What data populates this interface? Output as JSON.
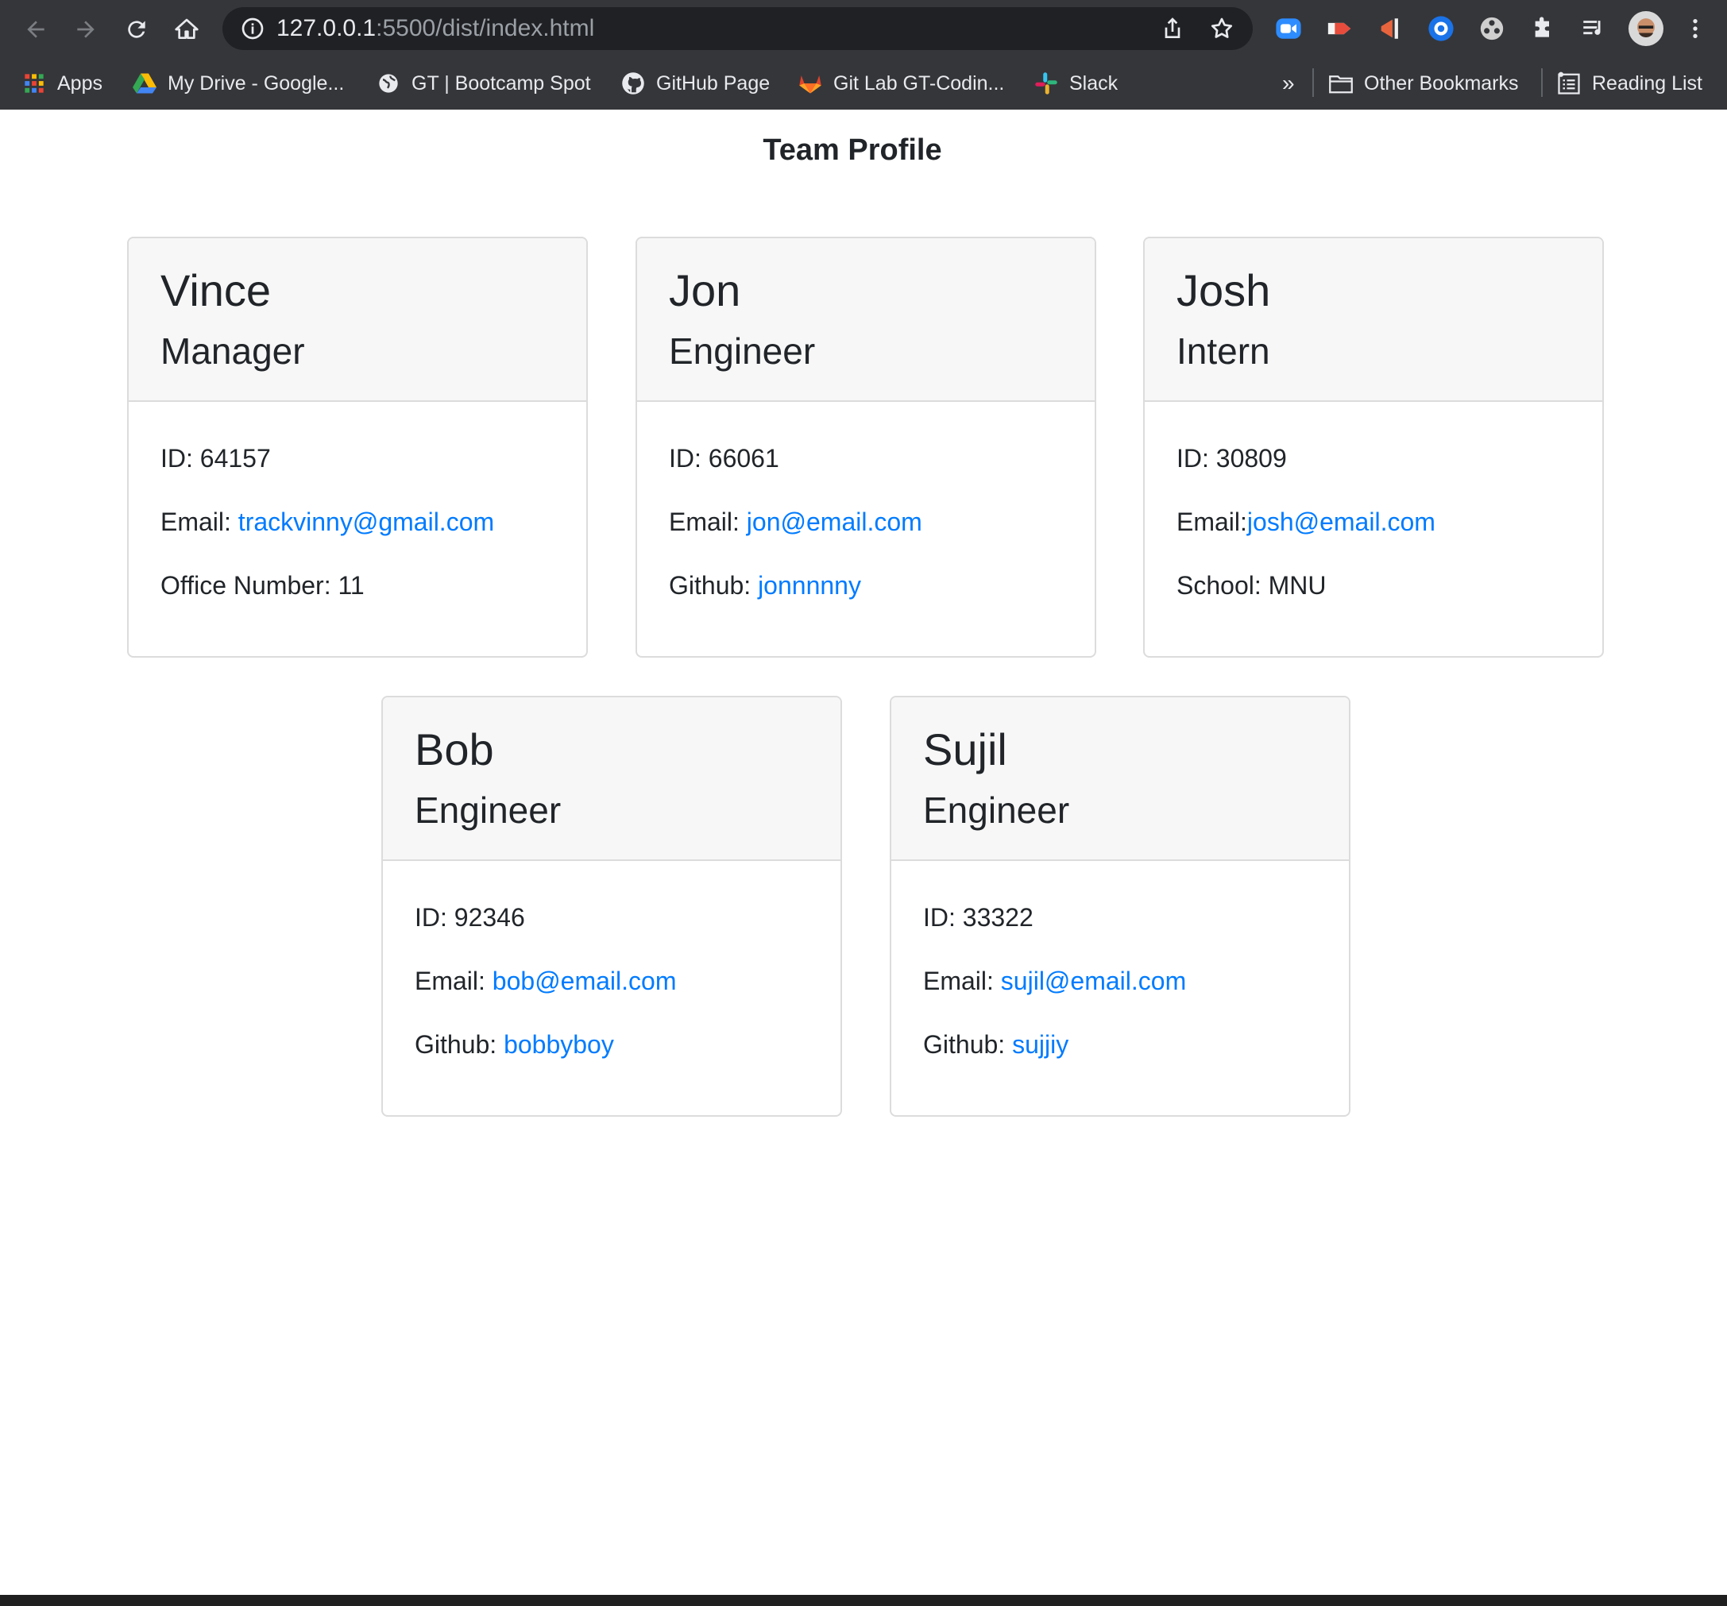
{
  "browser": {
    "url_host": "127.0.0.1",
    "url_path": ":5500/dist/index.html",
    "bookmarks": [
      {
        "label": "Apps",
        "icon": "apps-grid-icon"
      },
      {
        "label": "My Drive - Google...",
        "icon": "google-drive-icon"
      },
      {
        "label": "GT | Bootcamp Spot",
        "icon": "globe-icon"
      },
      {
        "label": "GitHub Page",
        "icon": "github-icon"
      },
      {
        "label": "Git Lab GT-Codin...",
        "icon": "gitlab-icon"
      },
      {
        "label": "Slack",
        "icon": "slack-icon"
      }
    ],
    "overflow_label": "»",
    "other_bookmarks": "Other Bookmarks",
    "reading_list": "Reading List"
  },
  "page": {
    "title": "Team Profile"
  },
  "team": [
    {
      "name": "Vince",
      "role": "Manager",
      "id_label": "ID: 64157",
      "email_label": "Email: ",
      "email": "trackvinny@gmail.com",
      "extra_label": "Office Number: 11",
      "extra_link": ""
    },
    {
      "name": "Jon",
      "role": "Engineer",
      "id_label": "ID: 66061",
      "email_label": "Email: ",
      "email": "jon@email.com",
      "extra_label": "Github: ",
      "extra_link": "jonnnnny"
    },
    {
      "name": "Josh",
      "role": "Intern",
      "id_label": "ID: 30809",
      "email_label": "Email:",
      "email": "josh@email.com",
      "extra_label": "School: MNU",
      "extra_link": ""
    },
    {
      "name": "Bob",
      "role": "Engineer",
      "id_label": "ID: 92346",
      "email_label": "Email: ",
      "email": "bob@email.com",
      "extra_label": "Github: ",
      "extra_link": "bobbyboy"
    },
    {
      "name": "Sujil",
      "role": "Engineer",
      "id_label": "ID: 33322",
      "email_label": "Email: ",
      "email": "sujil@email.com",
      "extra_label": "Github: ",
      "extra_link": "sujjiy"
    }
  ],
  "colors": {
    "link": "#007bff",
    "chrome_bg": "#35363a",
    "card_header_bg": "#f7f7f7"
  }
}
